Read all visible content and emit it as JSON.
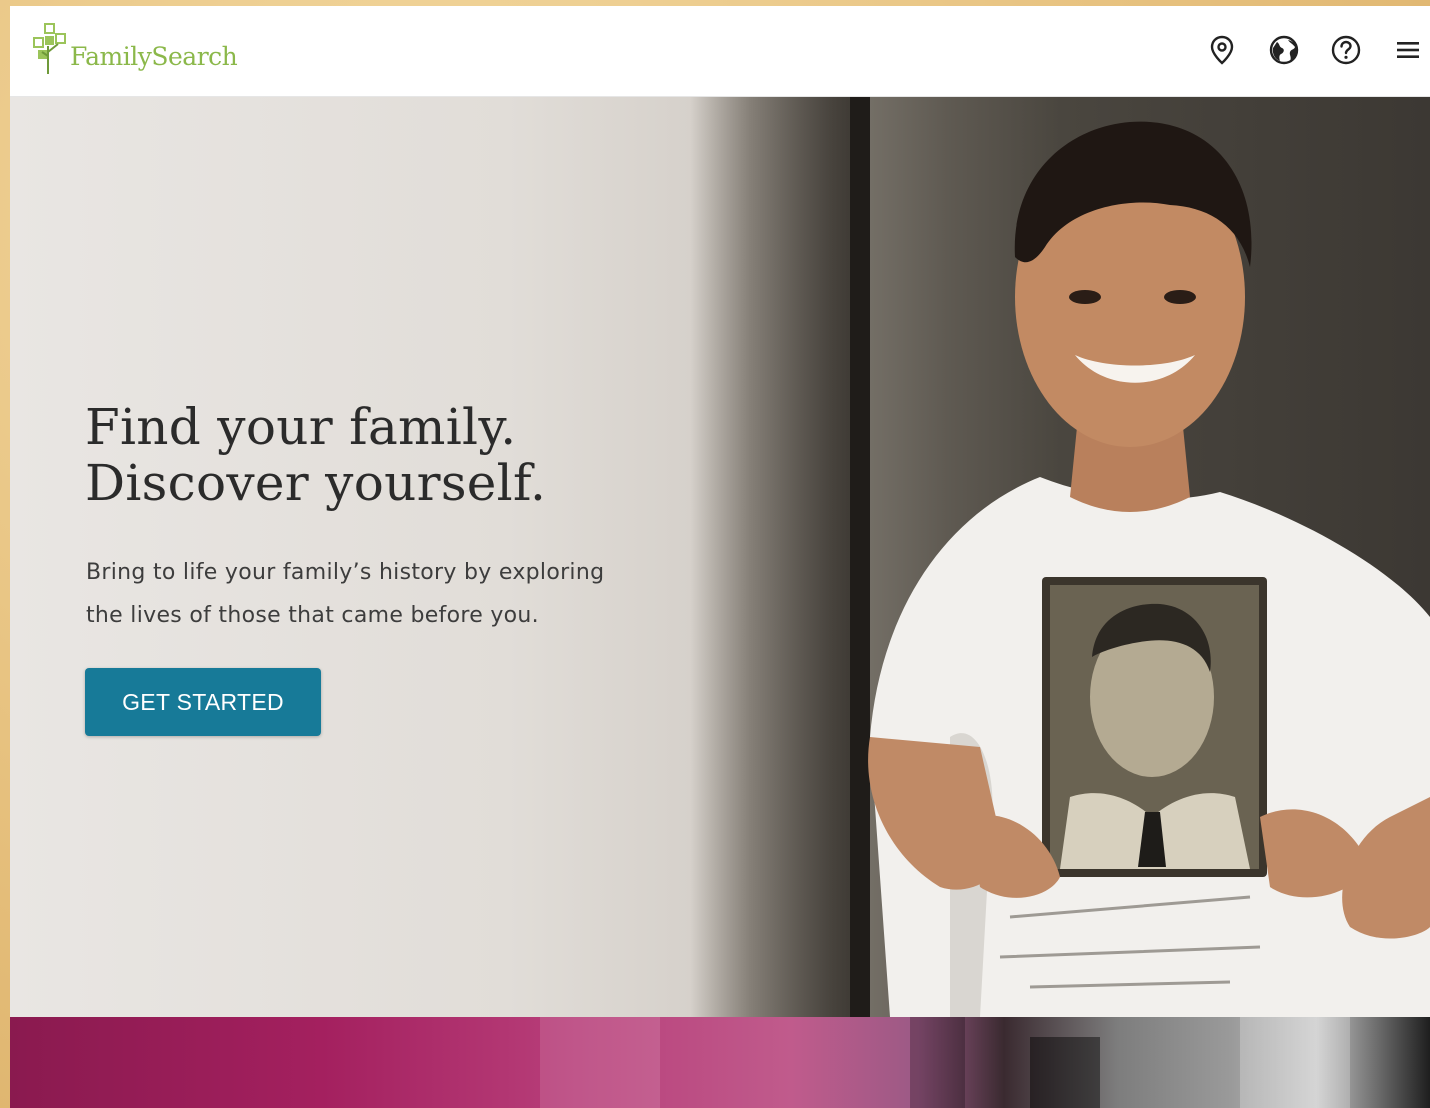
{
  "brand": {
    "name": "FamilySearch",
    "accent": "#8bb84a"
  },
  "header": {
    "icons": [
      {
        "name": "location-pin-icon"
      },
      {
        "name": "globe-icon"
      },
      {
        "name": "help-icon"
      },
      {
        "name": "menu-icon"
      }
    ]
  },
  "hero": {
    "headline_line1": "Find your family.",
    "headline_line2": "Discover yourself.",
    "subtext_line1": "Bring to life your family’s history by exploring",
    "subtext_line2": "the lives of those that came before you.",
    "cta_label": "GET STARTED",
    "cta_color": "#177a98"
  }
}
